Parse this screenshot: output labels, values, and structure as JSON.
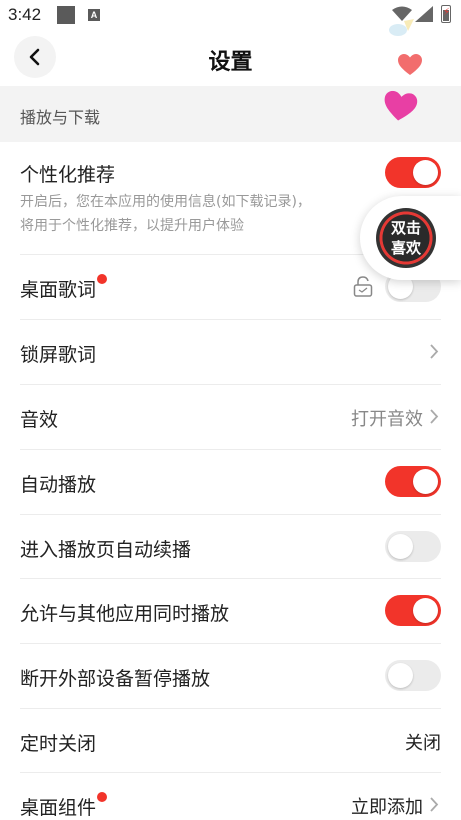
{
  "status_bar": {
    "time": "3:42",
    "a_icon": "A"
  },
  "header": {
    "title": "设置",
    "back_icon": "chevron-left-icon"
  },
  "section": {
    "title": "播放与下载"
  },
  "rows": {
    "personalized": {
      "label": "个性化推荐",
      "desc_line1": "开启后，您在本应用的使用信息(如下载记录)，",
      "desc_line2": "将用于个性化推荐，以提升用户体验",
      "toggle_on": true
    },
    "desktop_lyrics": {
      "label": "桌面歌词",
      "toggle_on": false,
      "new_badge": true,
      "lock_icon": "unlock-icon"
    },
    "lock_lyrics": {
      "label": "锁屏歌词"
    },
    "sound_effect": {
      "label": "音效",
      "value": "打开音效"
    },
    "autoplay": {
      "label": "自动播放",
      "toggle_on": true
    },
    "auto_continue": {
      "label": "进入播放页自动续播",
      "toggle_on": false
    },
    "play_with_others": {
      "label": "允许与其他应用同时播放",
      "toggle_on": true
    },
    "pause_on_disconnect": {
      "label": "断开外部设备暂停播放",
      "toggle_on": false
    },
    "sleep_timer": {
      "label": "定时关闭",
      "value": "关闭"
    },
    "desktop_widget": {
      "label": "桌面组件",
      "value": "立即添加",
      "new_badge": true
    }
  },
  "floating": {
    "line1": "双击",
    "line2": "喜欢"
  },
  "colors": {
    "accent": "#f2342a",
    "toggle_off": "#ebebeb",
    "section_bg": "#f3f3f3"
  }
}
